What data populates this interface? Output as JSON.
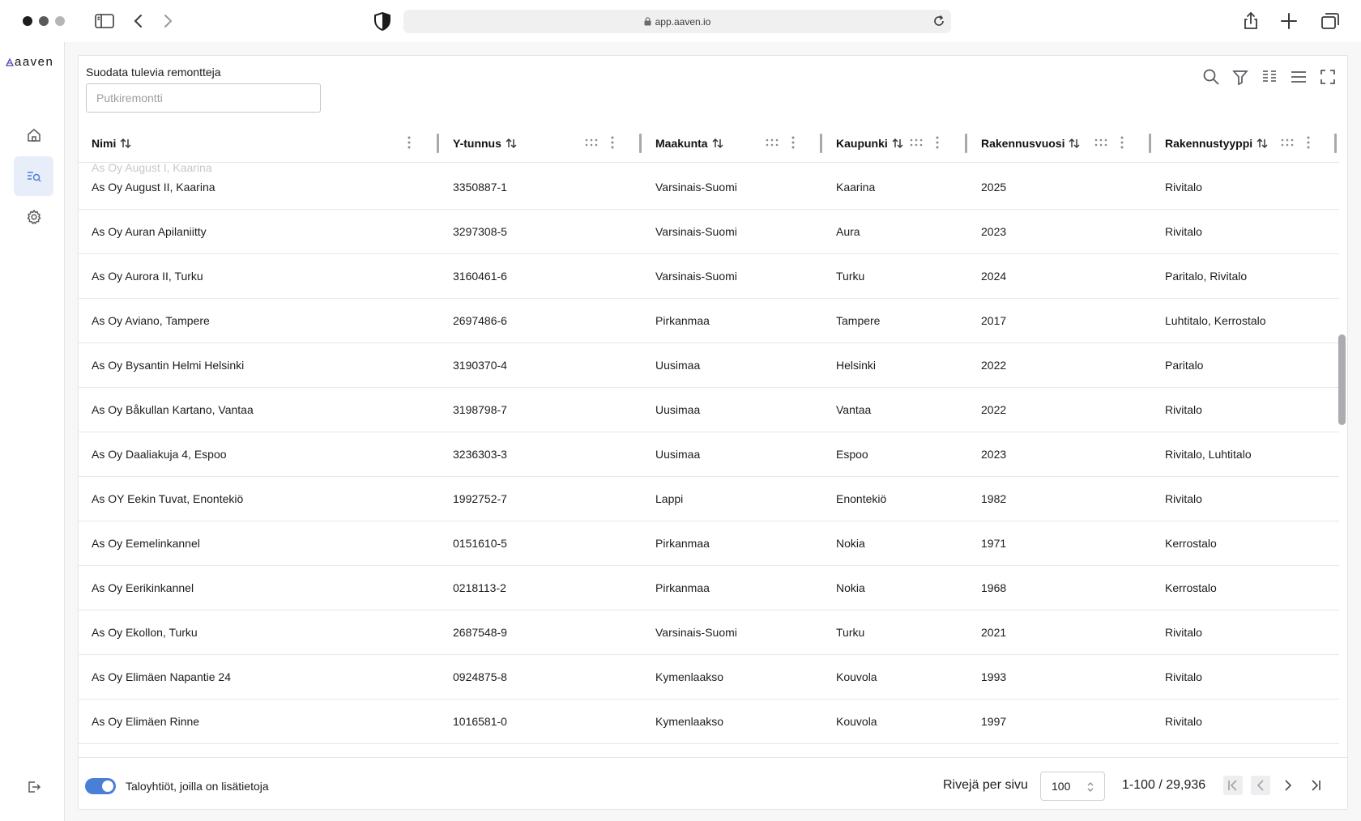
{
  "browser": {
    "url": "app.aaven.io"
  },
  "app": {
    "logo_text": "aaven"
  },
  "filter": {
    "label": "Suodata tulevia remontteja",
    "placeholder": "Putkiremontti",
    "value": ""
  },
  "table": {
    "columns": [
      "Nimi",
      "Y-tunnus",
      "Maakunta",
      "Kaupunki",
      "Rakennusvuosi",
      "Rakennustyyppi"
    ],
    "ghost_row_text": "As Oy August I, Kaarina",
    "rows": [
      [
        "As Oy August II, Kaarina",
        "3350887-1",
        "Varsinais-Suomi",
        "Kaarina",
        "2025",
        "Rivitalo"
      ],
      [
        "As Oy Auran Apilaniitty",
        "3297308-5",
        "Varsinais-Suomi",
        "Aura",
        "2023",
        "Rivitalo"
      ],
      [
        "As Oy Aurora II, Turku",
        "3160461-6",
        "Varsinais-Suomi",
        "Turku",
        "2024",
        "Paritalo, Rivitalo"
      ],
      [
        "As Oy Aviano, Tampere",
        "2697486-6",
        "Pirkanmaa",
        "Tampere",
        "2017",
        "Luhtitalo, Kerrostalo"
      ],
      [
        "As Oy Bysantin Helmi Helsinki",
        "3190370-4",
        "Uusimaa",
        "Helsinki",
        "2022",
        "Paritalo"
      ],
      [
        "As Oy Båkullan Kartano, Vantaa",
        "3198798-7",
        "Uusimaa",
        "Vantaa",
        "2022",
        "Rivitalo"
      ],
      [
        "As Oy Daaliakuja 4, Espoo",
        "3236303-3",
        "Uusimaa",
        "Espoo",
        "2023",
        "Rivitalo, Luhtitalo"
      ],
      [
        "As OY Eekin Tuvat, Enontekiö",
        "1992752-7",
        "Lappi",
        "Enontekiö",
        "1982",
        "Rivitalo"
      ],
      [
        "As Oy Eemelinkannel",
        "0151610-5",
        "Pirkanmaa",
        "Nokia",
        "1971",
        "Kerrostalo"
      ],
      [
        "As Oy Eerikinkannel",
        "0218113-2",
        "Pirkanmaa",
        "Nokia",
        "1968",
        "Kerrostalo"
      ],
      [
        "As Oy Ekollon, Turku",
        "2687548-9",
        "Varsinais-Suomi",
        "Turku",
        "2021",
        "Rivitalo"
      ],
      [
        "As Oy Elimäen Napantie 24",
        "0924875-8",
        "Kymenlaakso",
        "Kouvola",
        "1993",
        "Rivitalo"
      ],
      [
        "As Oy Elimäen Rinne",
        "1016581-0",
        "Kymenlaakso",
        "Kouvola",
        "1997",
        "Rivitalo"
      ]
    ]
  },
  "footer": {
    "toggle_label": "Taloyhtiöt, joilla on lisätietoja",
    "toggle_on": true,
    "rows_per_page_label": "Rivejä per sivu",
    "rows_per_page_value": "100",
    "range_text": "1-100 / 29,936"
  },
  "colors": {
    "accent": "#4a7fd8",
    "active_nav_bg": "#e8eef9"
  }
}
